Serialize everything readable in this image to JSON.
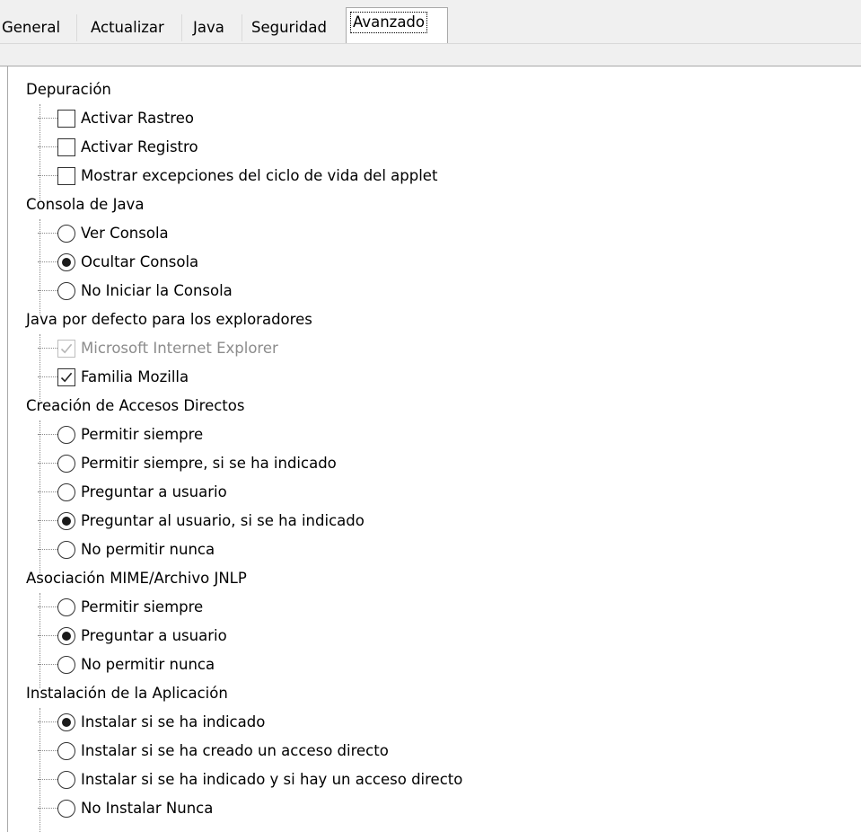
{
  "tabs": [
    {
      "label": "General",
      "active": false
    },
    {
      "label": "Actualizar",
      "active": false
    },
    {
      "label": "Java",
      "active": false
    },
    {
      "label": "Seguridad",
      "active": false
    },
    {
      "label": "Avanzado",
      "active": true
    }
  ],
  "groups": {
    "debug": {
      "title": "Depuración",
      "items": [
        {
          "label": "Activar Rastreo",
          "control": "checkbox",
          "checked": false
        },
        {
          "label": "Activar Registro",
          "control": "checkbox",
          "checked": false
        },
        {
          "label": "Mostrar excepciones del ciclo de vida del applet",
          "control": "checkbox",
          "checked": false
        }
      ]
    },
    "console": {
      "title": "Consola de Java",
      "items": [
        {
          "label": "Ver Consola",
          "control": "radio",
          "checked": false
        },
        {
          "label": "Ocultar Consola",
          "control": "radio",
          "checked": true
        },
        {
          "label": "No Iniciar la Consola",
          "control": "radio",
          "checked": false
        }
      ]
    },
    "browsers": {
      "title": "Java por defecto para los exploradores",
      "items": [
        {
          "label": "Microsoft Internet Explorer",
          "control": "checkbox",
          "checked": true,
          "disabled": true
        },
        {
          "label": "Familia Mozilla",
          "control": "checkbox",
          "checked": true
        }
      ]
    },
    "shortcuts": {
      "title": "Creación de Accesos Directos",
      "items": [
        {
          "label": "Permitir siempre",
          "control": "radio",
          "checked": false
        },
        {
          "label": "Permitir siempre, si se ha indicado",
          "control": "radio",
          "checked": false
        },
        {
          "label": "Preguntar a usuario",
          "control": "radio",
          "checked": false
        },
        {
          "label": "Preguntar al usuario, si se ha indicado",
          "control": "radio",
          "checked": true
        },
        {
          "label": "No permitir nunca",
          "control": "radio",
          "checked": false
        }
      ]
    },
    "mime": {
      "title": "Asociación MIME/Archivo JNLP",
      "items": [
        {
          "label": "Permitir siempre",
          "control": "radio",
          "checked": false
        },
        {
          "label": "Preguntar a usuario",
          "control": "radio",
          "checked": true
        },
        {
          "label": "No permitir nunca",
          "control": "radio",
          "checked": false
        }
      ]
    },
    "install": {
      "title": "Instalación de la Aplicación",
      "items": [
        {
          "label": "Instalar si se ha indicado",
          "control": "radio",
          "checked": true
        },
        {
          "label": "Instalar si se ha creado un acceso directo",
          "control": "radio",
          "checked": false
        },
        {
          "label": "Instalar si se ha indicado y si hay un acceso directo",
          "control": "radio",
          "checked": false
        },
        {
          "label": "No Instalar Nunca",
          "control": "radio",
          "checked": false
        }
      ]
    }
  }
}
